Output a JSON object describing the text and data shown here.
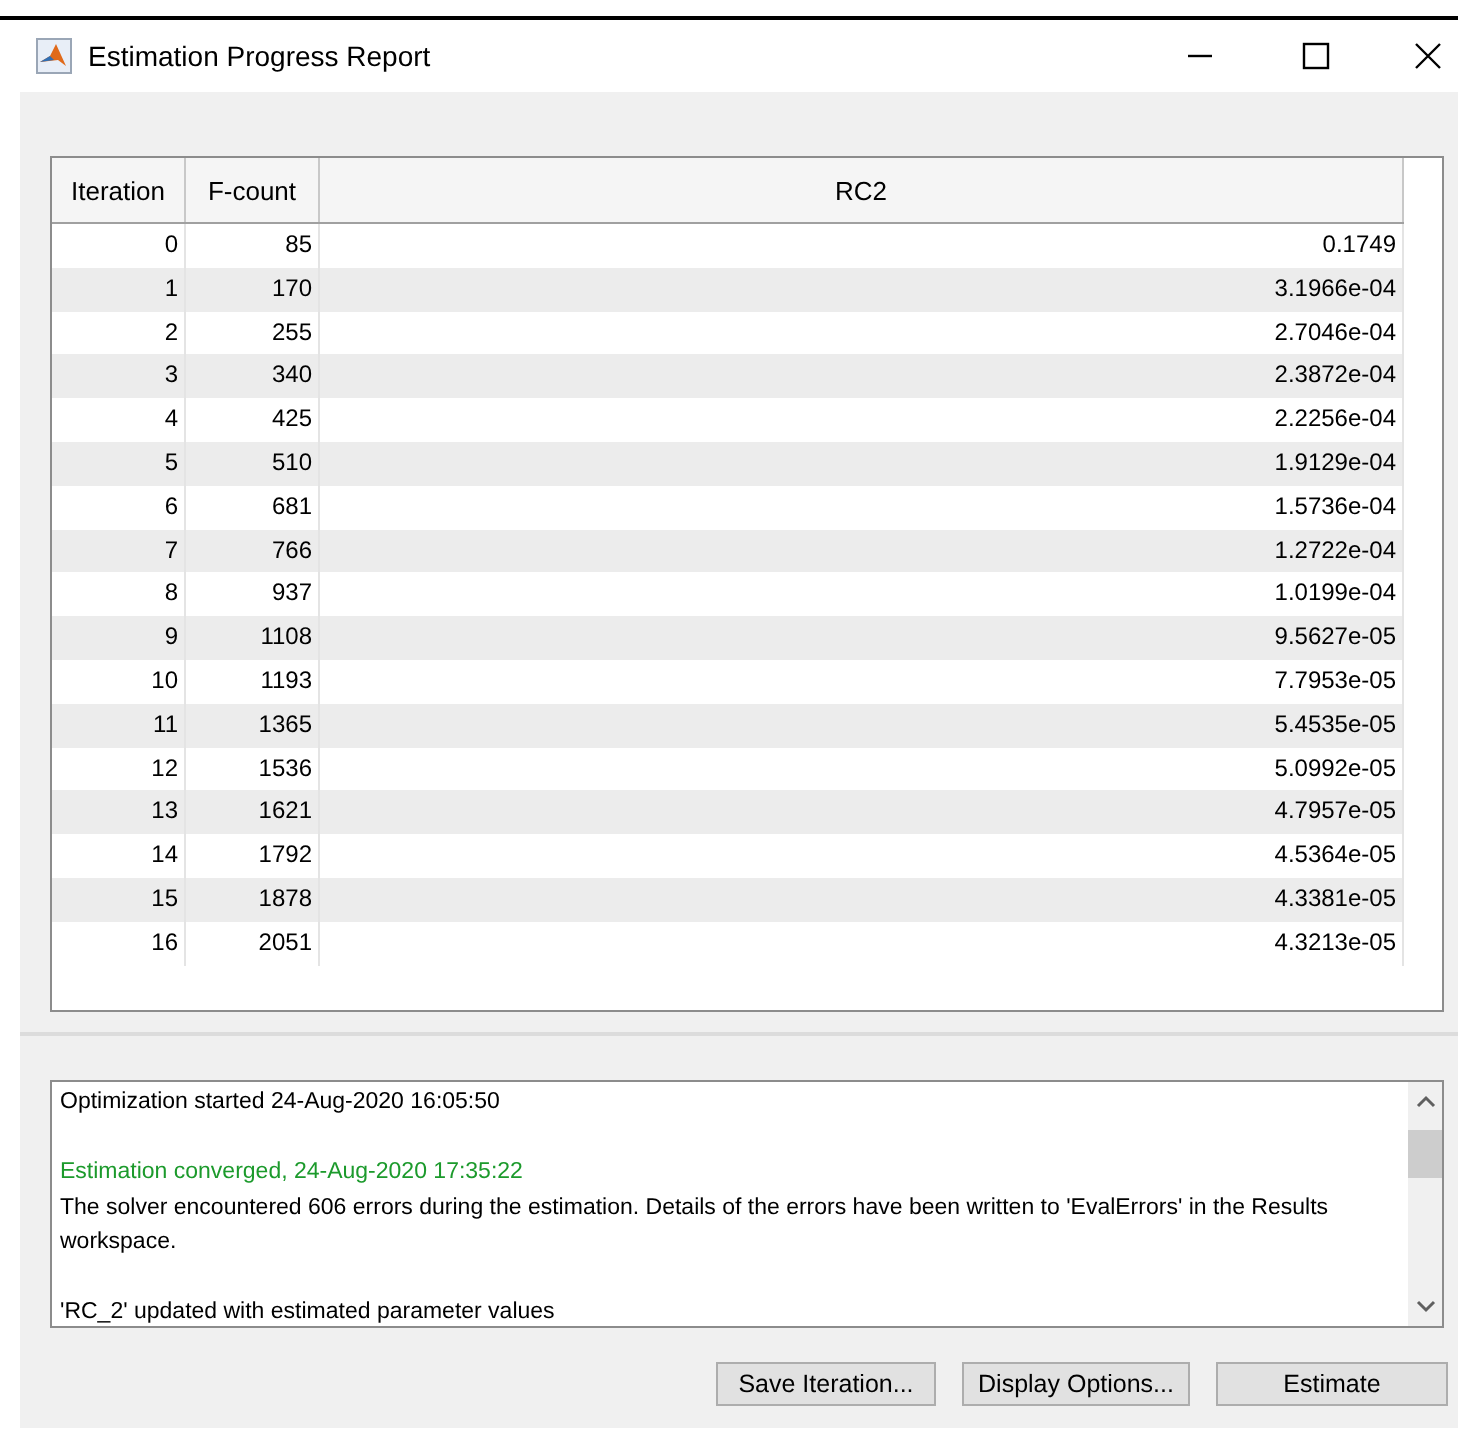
{
  "window": {
    "title": "Estimation Progress Report"
  },
  "table": {
    "columns": [
      "Iteration",
      "F-count",
      "RC2"
    ],
    "rows": [
      [
        "0",
        "85",
        "0.1749"
      ],
      [
        "1",
        "170",
        "3.1966e-04"
      ],
      [
        "2",
        "255",
        "2.7046e-04"
      ],
      [
        "3",
        "340",
        "2.3872e-04"
      ],
      [
        "4",
        "425",
        "2.2256e-04"
      ],
      [
        "5",
        "510",
        "1.9129e-04"
      ],
      [
        "6",
        "681",
        "1.5736e-04"
      ],
      [
        "7",
        "766",
        "1.2722e-04"
      ],
      [
        "8",
        "937",
        "1.0199e-04"
      ],
      [
        "9",
        "1108",
        "9.5627e-05"
      ],
      [
        "10",
        "1193",
        "7.7953e-05"
      ],
      [
        "11",
        "1365",
        "5.4535e-05"
      ],
      [
        "12",
        "1536",
        "5.0992e-05"
      ],
      [
        "13",
        "1621",
        "4.7957e-05"
      ],
      [
        "14",
        "1792",
        "4.5364e-05"
      ],
      [
        "15",
        "1878",
        "4.3381e-05"
      ],
      [
        "16",
        "2051",
        "4.3213e-05"
      ]
    ]
  },
  "log": [
    {
      "kind": "plain",
      "text": "Optimization started 24-Aug-2020 16:05:50"
    },
    {
      "kind": "blank"
    },
    {
      "kind": "success",
      "text": "Estimation converged, 24-Aug-2020 17:35:22"
    },
    {
      "kind": "plain",
      "text": "The solver encountered 606 errors during the estimation. Details of the errors have been written to 'EvalErrors' in the Results workspace."
    },
    {
      "kind": "blank"
    },
    {
      "kind": "plain",
      "text": "'RC_2' updated with estimated parameter values"
    }
  ],
  "buttons": [
    "Save Iteration...",
    "Display Options...",
    "Estimate"
  ]
}
